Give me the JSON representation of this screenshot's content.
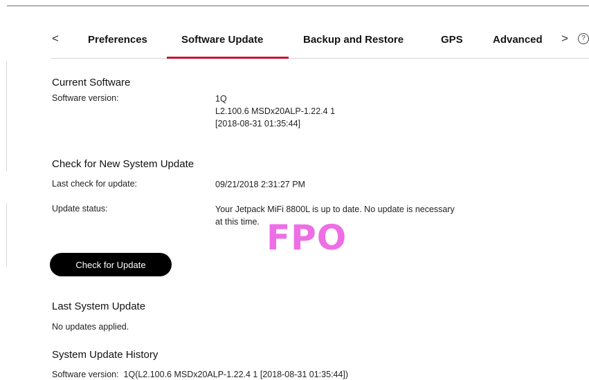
{
  "tabs": {
    "prev": "<",
    "next": ">",
    "help": "?",
    "items": [
      {
        "label": "Preferences"
      },
      {
        "label": "Software Update"
      },
      {
        "label": "Backup and Restore"
      },
      {
        "label": "GPS"
      },
      {
        "label": "Advanced"
      }
    ],
    "active": "Software Update",
    "accent_color": "#c8102e"
  },
  "current_software": {
    "heading": "Current Software",
    "version_label": "Software version:",
    "version_lines": [
      "1Q",
      "L2.100.6 MSDx20ALP-1.22.4 1",
      "[2018-08-31 01:35:44]"
    ]
  },
  "check_update": {
    "heading": "Check for New System Update",
    "last_check_label": "Last check for update:",
    "last_check_value": "09/21/2018 2:31:27 PM",
    "status_label": "Update status:",
    "status_lines": [
      "Your Jetpack MiFi 8800L is up to date. No update is necessary",
      "at this time."
    ],
    "button_label": "Check for Update"
  },
  "watermark": {
    "text": "FPO",
    "color": "#ee6ee5"
  },
  "last_update": {
    "heading": "Last System Update",
    "text": "No updates applied."
  },
  "history": {
    "heading": "System Update History",
    "entry": "Software version:  1Q(L2.100.6 MSDx20ALP-1.22.4 1 [2018-08-31 01:35:44])"
  }
}
